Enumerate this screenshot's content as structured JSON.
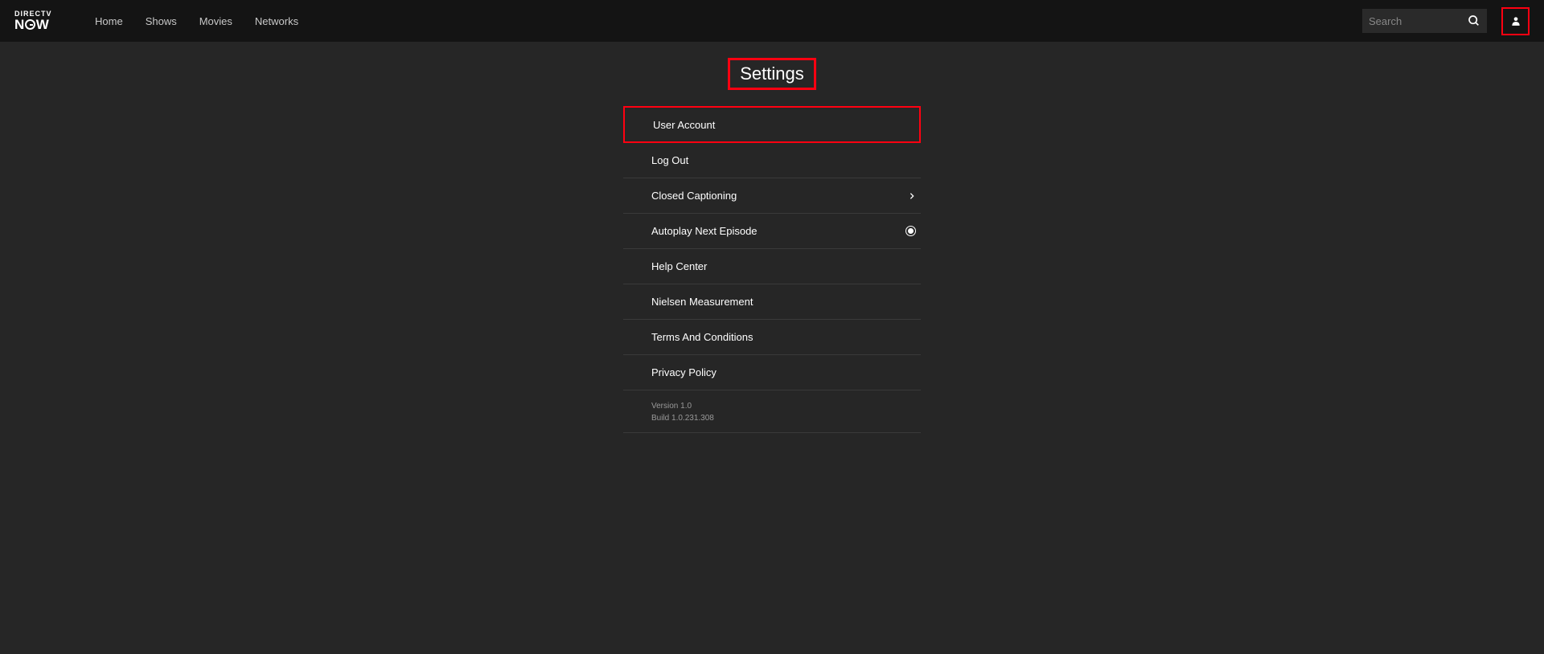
{
  "header": {
    "logo": {
      "line1": "DIRECTV",
      "line2_pre": "N",
      "line2_post": "W"
    },
    "nav": [
      "Home",
      "Shows",
      "Movies",
      "Networks"
    ],
    "search": {
      "placeholder": "Search"
    }
  },
  "page": {
    "title": "Settings"
  },
  "settings": {
    "items": [
      {
        "label": "User Account",
        "highlighted": true,
        "chevron": false,
        "radio": false
      },
      {
        "label": "Log Out",
        "highlighted": false,
        "chevron": false,
        "radio": false
      },
      {
        "label": "Closed Captioning",
        "highlighted": false,
        "chevron": true,
        "radio": false
      },
      {
        "label": "Autoplay Next Episode",
        "highlighted": false,
        "chevron": false,
        "radio": true
      },
      {
        "label": "Help Center",
        "highlighted": false,
        "chevron": false,
        "radio": false
      },
      {
        "label": "Nielsen Measurement",
        "highlighted": false,
        "chevron": false,
        "radio": false
      },
      {
        "label": "Terms And Conditions",
        "highlighted": false,
        "chevron": false,
        "radio": false
      },
      {
        "label": "Privacy Policy",
        "highlighted": false,
        "chevron": false,
        "radio": false
      }
    ],
    "version": "Version 1.0",
    "build": "Build 1.0.231.308"
  }
}
